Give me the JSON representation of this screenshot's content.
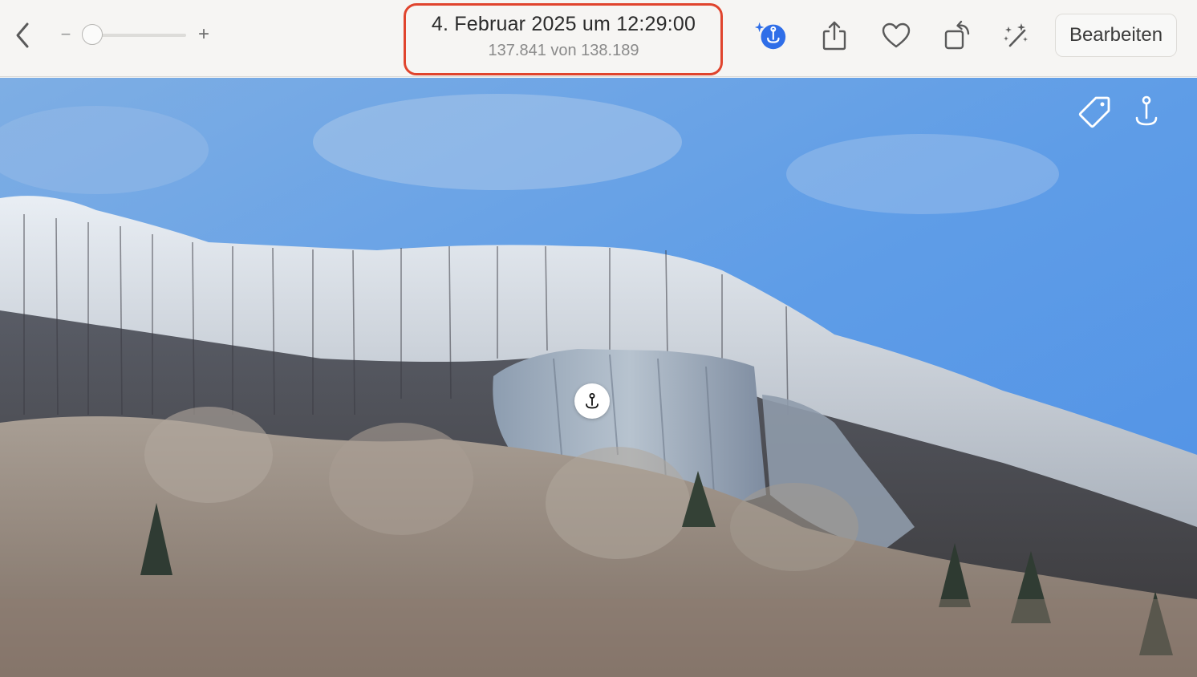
{
  "toolbar": {
    "zoom_minus": "−",
    "zoom_plus": "+",
    "zoom_level": 0.0,
    "title_date": "4. Februar 2025 um 12:29:00",
    "photo_count": "137.841 von 138.189",
    "edit_label": "Bearbeiten",
    "icons": [
      "back-chevron-icon",
      "visual-lookup-icon",
      "share-icon",
      "heart-icon",
      "rotate-icon",
      "magic-wand-icon"
    ]
  },
  "photo": {
    "overlay_icons": [
      "tag-icon",
      "visual-lookup-icon"
    ],
    "subject_marker_icon": "visual-lookup-pin-icon"
  },
  "colors": {
    "accent": "#2f6ee8",
    "highlight": "#e0442d",
    "toolbar_bg": "#f6f5f3",
    "sky": "#5e9ee8"
  }
}
